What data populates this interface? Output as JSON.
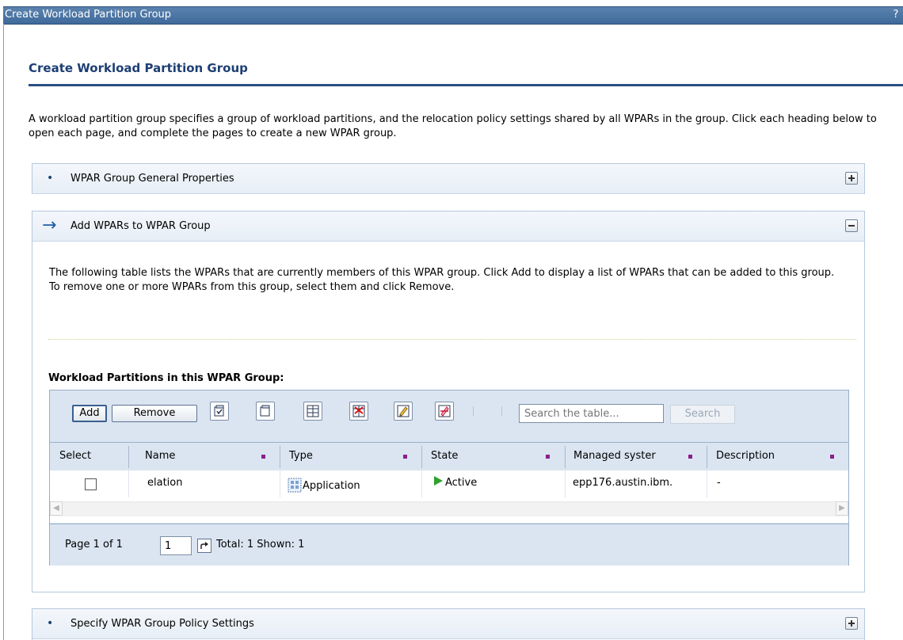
{
  "window": {
    "title": "Create Workload Partition Group",
    "help_label": "? !"
  },
  "page": {
    "title": "Create Workload Partition Group",
    "intro": "A workload partition group specifies a group of workload partitions, and the relocation policy settings shared by all WPARs in the group. Click each heading below to open each page, and complete the pages to create a new WPAR group."
  },
  "sections": [
    {
      "label": "WPAR Group General Properties",
      "state": "collapsed",
      "icon": "bullet-icon",
      "toggle_icon": "expand-plus-icon"
    },
    {
      "label": "Add WPARs to WPAR Group",
      "state": "expanded",
      "icon": "arrow-right-icon",
      "toggle_icon": "collapse-minus-icon"
    },
    {
      "label": "Specify WPAR Group Policy Settings",
      "state": "collapsed",
      "icon": "bullet-icon",
      "toggle_icon": "expand-plus-icon"
    }
  ],
  "bullet": "•",
  "arrow": "→",
  "add_section": {
    "description": "The following table lists the WPARs that are currently members of this WPAR group. Click Add to display a list of WPARs that can be added to this group. To remove one or more WPARs from this group, select them and click Remove.",
    "table_title": "Workload Partitions in this WPAR Group:"
  },
  "toolbar": {
    "add_label": "Add",
    "remove_label": "Remove",
    "icons": [
      "select-all-icon",
      "deselect-all-icon",
      "show-filter-row-icon",
      "clear-filters-icon",
      "edit-sort-icon",
      "clear-sorts-icon"
    ],
    "search_placeholder": "Search the table...",
    "search_button": "Search"
  },
  "table": {
    "columns": [
      "Select",
      "Name",
      "Type",
      "State",
      "Managed syster",
      "Description"
    ],
    "rows": [
      {
        "name": "elation",
        "type": "Application",
        "state": "Active",
        "managed_system": "epp176.austin.ibm.",
        "description": "-"
      }
    ],
    "type_icon": "application-icon",
    "state_icon": "active-play-icon"
  },
  "pager": {
    "page_label": "Page 1 of 1",
    "page_value": "1",
    "totals": "Total: 1 Shown: 1"
  },
  "colors": {
    "title_blue": "#1d3f73",
    "sort_marker": "#8a1f8a",
    "active_green": "#2ea12e"
  }
}
